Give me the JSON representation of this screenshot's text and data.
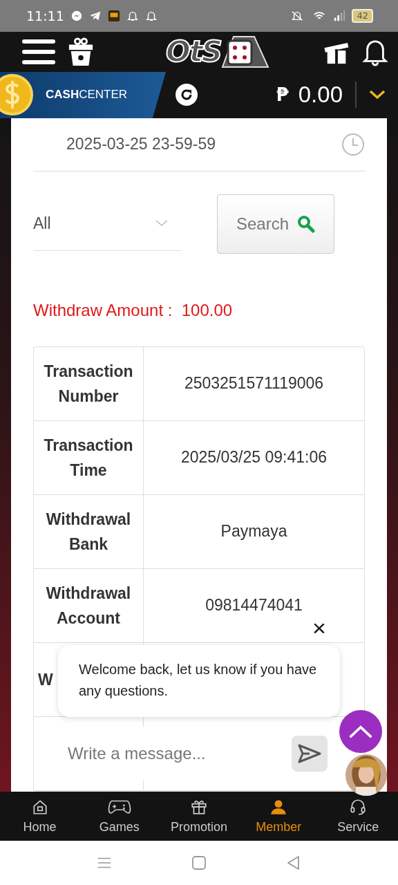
{
  "status_bar": {
    "time": "11:11",
    "battery": "42"
  },
  "header": {
    "logo": "OtS"
  },
  "cash_bar": {
    "label_bold": "CASH",
    "label": "CENTER",
    "currency": "₱",
    "balance": "0.00"
  },
  "filters": {
    "end_date": "2025-03-25 23-59-59",
    "type": "All",
    "search_button": "Search"
  },
  "withdraw_amount": {
    "label": "Withdraw Amount :",
    "value": "100.00"
  },
  "table": {
    "rows": [
      {
        "label": "Transaction Number",
        "value": "2503251571119006"
      },
      {
        "label": "Transaction Time",
        "value": "2025/03/25 09:41:06"
      },
      {
        "label": "Withdrawal Bank",
        "value": "Paymaya"
      },
      {
        "label": "Withdrawal Account",
        "value": "09814474041"
      },
      {
        "label": "W",
        "value": ""
      }
    ]
  },
  "chat": {
    "close": "×",
    "message": "Welcome back, let us know if you have any questions.",
    "placeholder": "Write a message..."
  },
  "bottom_nav": [
    {
      "label": "Home",
      "kind": "home",
      "selected": false
    },
    {
      "label": "Games",
      "kind": "games",
      "selected": false
    },
    {
      "label": "Promotion",
      "kind": "promotion",
      "selected": false
    },
    {
      "label": "Member",
      "kind": "member",
      "selected": true
    },
    {
      "label": "Service",
      "kind": "service",
      "selected": false
    }
  ]
}
